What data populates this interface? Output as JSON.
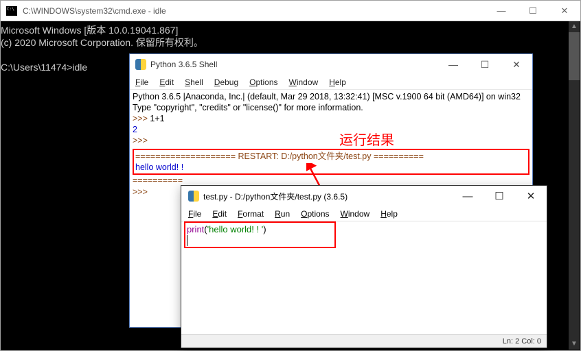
{
  "cmd": {
    "title": "C:\\WINDOWS\\system32\\cmd.exe - idle",
    "line1": "Microsoft Windows [版本 10.0.19041.867]",
    "line2": "(c) 2020 Microsoft Corporation. 保留所有权利。",
    "prompt": "C:\\Users\\11474>",
    "command": "idle"
  },
  "shell": {
    "title": "Python 3.6.5 Shell",
    "menu": {
      "file": "File",
      "edit": "Edit",
      "shell": "Shell",
      "debug": "Debug",
      "options": "Options",
      "window": "Window",
      "help": "Help"
    },
    "banner1": "Python 3.6.5 |Anaconda, Inc.| (default, Mar 29 2018, 13:32:41) [MSC v.1900 64 bit (AMD64)] on win32",
    "banner2": "Type \"copyright\", \"credits\" or \"license()\" for more information.",
    "prompt": ">>> ",
    "input1": "1+1",
    "output1": "2",
    "restart": "==================== RESTART: D:/python文件夹/test.py ==========",
    "restart_tail": "==========",
    "hello": "hello world! !",
    "empty_prompt": ">>>"
  },
  "annotation": {
    "label": "运行结果"
  },
  "editor": {
    "title": "test.py - D:/python文件夹/test.py (3.6.5)",
    "menu": {
      "file": "File",
      "edit": "Edit",
      "format": "Format",
      "run": "Run",
      "options": "Options",
      "window": "Window",
      "help": "Help"
    },
    "code_print": "print",
    "code_paren_open": "(",
    "code_string": "'hello world! ! '",
    "code_paren_close": ")",
    "status": "Ln: 2  Col: 0"
  },
  "win_controls": {
    "min": "—",
    "max": "☐",
    "close": "✕"
  }
}
